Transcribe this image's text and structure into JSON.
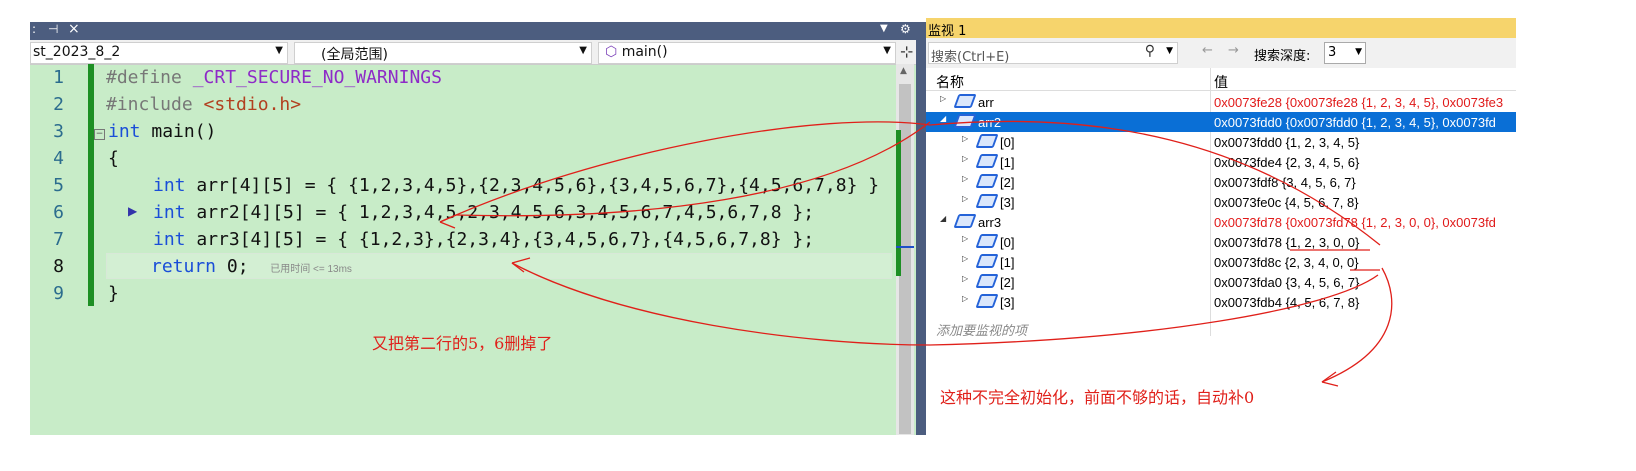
{
  "editor": {
    "tab_close": "×",
    "tab_pin": "⊣",
    "tab_colon": ":",
    "nav": {
      "project": "st_2023_8_2",
      "scope": "(全局范围)",
      "function": "main()"
    },
    "lines": [
      {
        "num": "1",
        "pre": "#define ",
        "macro": "_CRT_SECURE_NO_WARNINGS"
      },
      {
        "num": "2",
        "pre": "#include ",
        "str": "<stdio.h>"
      },
      {
        "num": "3",
        "kw": "int",
        "rest": " main()"
      },
      {
        "num": "4",
        "rest": "{"
      },
      {
        "num": "5",
        "kw": "int",
        "rest": " arr[4][5] = { {1,2,3,4,5},{2,3,4,5,6},{3,4,5,6,7},{4,5,6,7,8} }"
      },
      {
        "num": "6",
        "kw": "int",
        "rest": " arr2[4][5] = { 1,2,3,4,5,2,3,4,5,6,3,4,5,6,7,4,5,6,7,8 };"
      },
      {
        "num": "7",
        "kw": "int",
        "rest": " arr3[4][5] = { {1,2,3},{2,3,4},{3,4,5,6,7},{4,5,6,7,8} };"
      },
      {
        "num": "8",
        "kw": "return",
        "rest": " 0;",
        "hint": "已用时间 <= 13ms"
      },
      {
        "num": "9",
        "rest": "}"
      }
    ]
  },
  "watch": {
    "title": "监视 1",
    "search_placeholder": "搜索(Ctrl+E)",
    "depth_label": "搜索深度:",
    "depth_value": "3",
    "col_name": "名称",
    "col_value": "值",
    "rows": [
      {
        "name": "arr",
        "value": "0x0073fe28 {0x0073fe28 {1, 2, 3, 4, 5}, 0x0073fe3",
        "level": 0,
        "expanded": false,
        "red": true
      },
      {
        "name": "arr2",
        "value": "0x0073fdd0 {0x0073fdd0 {1, 2, 3, 4, 5}, 0x0073fd",
        "level": 0,
        "expanded": true,
        "selected": true
      },
      {
        "name": "[0]",
        "value": "0x0073fdd0 {1, 2, 3, 4, 5}",
        "level": 1
      },
      {
        "name": "[1]",
        "value": "0x0073fde4 {2, 3, 4, 5, 6}",
        "level": 1
      },
      {
        "name": "[2]",
        "value": "0x0073fdf8 {3, 4, 5, 6, 7}",
        "level": 1
      },
      {
        "name": "[3]",
        "value": "0x0073fe0c {4, 5, 6, 7, 8}",
        "level": 1
      },
      {
        "name": "arr3",
        "value": "0x0073fd78 {0x0073fd78 {1, 2, 3, 0, 0}, 0x0073fd",
        "level": 0,
        "expanded": true,
        "red": true
      },
      {
        "name": "[0]",
        "value": "0x0073fd78 {1, 2, 3, 0, 0}",
        "level": 1
      },
      {
        "name": "[1]",
        "value": "0x0073fd8c {2, 3, 4, 0, 0}",
        "level": 1
      },
      {
        "name": "[2]",
        "value": "0x0073fda0 {3, 4, 5, 6, 7}",
        "level": 1
      },
      {
        "name": "[3]",
        "value": "0x0073fdb4 {4, 5, 6, 7, 8}",
        "level": 1
      }
    ],
    "add_item": "添加要监视的项"
  },
  "annotations": {
    "note1": "又把第二行的5，6删掉了",
    "note2": "这种不完全初始化，前面不够的话，自动补0"
  },
  "colors": {
    "editor_bg": "#c8ecc8",
    "annotation": "#e0201a",
    "selection": "#0a6fd6"
  }
}
